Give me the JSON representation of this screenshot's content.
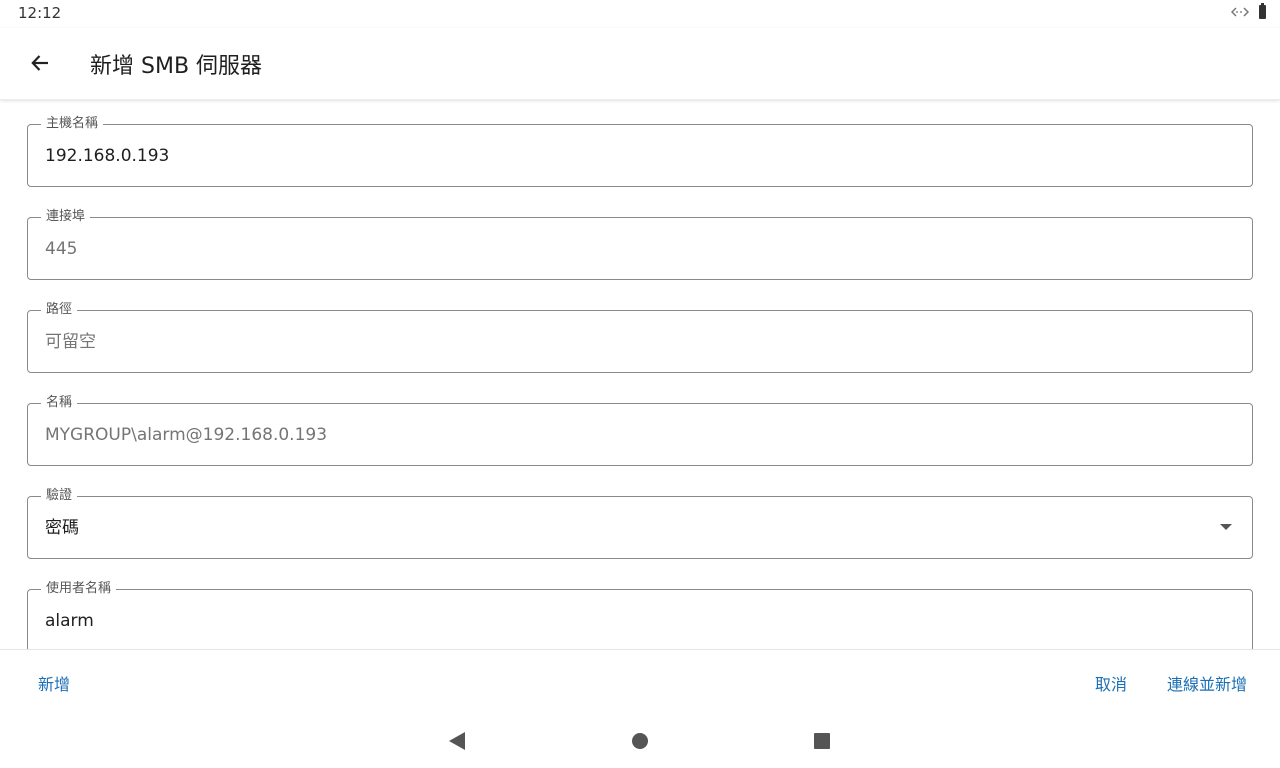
{
  "status_bar": {
    "time": "12:12",
    "icons": [
      "link-icon",
      "battery-icon"
    ]
  },
  "app_bar": {
    "back_icon": "arrow-back-icon",
    "title": "新增 SMB 伺服器"
  },
  "form": {
    "hostname": {
      "label": "主機名稱",
      "value": "192.168.0.193"
    },
    "port": {
      "label": "連接埠",
      "placeholder": "445"
    },
    "path": {
      "label": "路徑",
      "placeholder": "可留空"
    },
    "name": {
      "label": "名稱",
      "placeholder": "MYGROUP\\alarm@192.168.0.193"
    },
    "auth": {
      "label": "驗證",
      "value": "密碼",
      "icon": "dropdown-arrow-icon"
    },
    "username": {
      "label": "使用者名稱",
      "value": "alarm"
    }
  },
  "actions": {
    "add_label": "新增",
    "cancel_label": "取消",
    "connect_label": "連線並新增",
    "accent_color": "#1a6fb5"
  },
  "nav_bar": {
    "icons": [
      "nav-back-icon",
      "nav-home-icon",
      "nav-recents-icon"
    ]
  }
}
